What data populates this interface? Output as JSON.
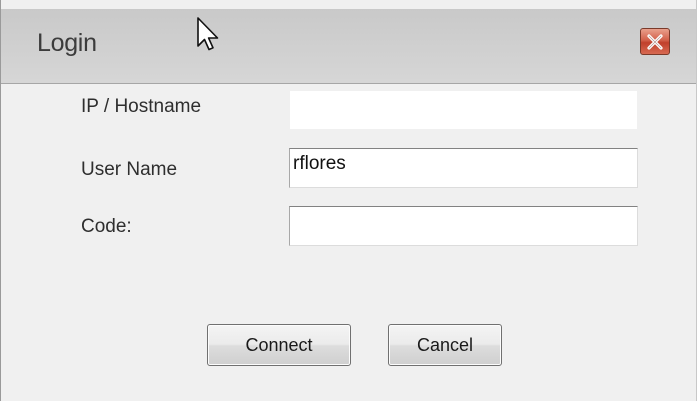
{
  "window": {
    "title": "Login",
    "close_icon": "close-x-icon"
  },
  "form": {
    "host_label": "IP / Hostname",
    "host_value": "",
    "user_label": "User Name",
    "user_value": "rflores",
    "code_label": "Code:",
    "code_value": ""
  },
  "buttons": {
    "connect_label": "Connect",
    "cancel_label": "Cancel"
  },
  "colors": {
    "close_button": "#c0402c",
    "titlebar": "#cfcfcf",
    "dialog_background": "#f0f0f0"
  }
}
